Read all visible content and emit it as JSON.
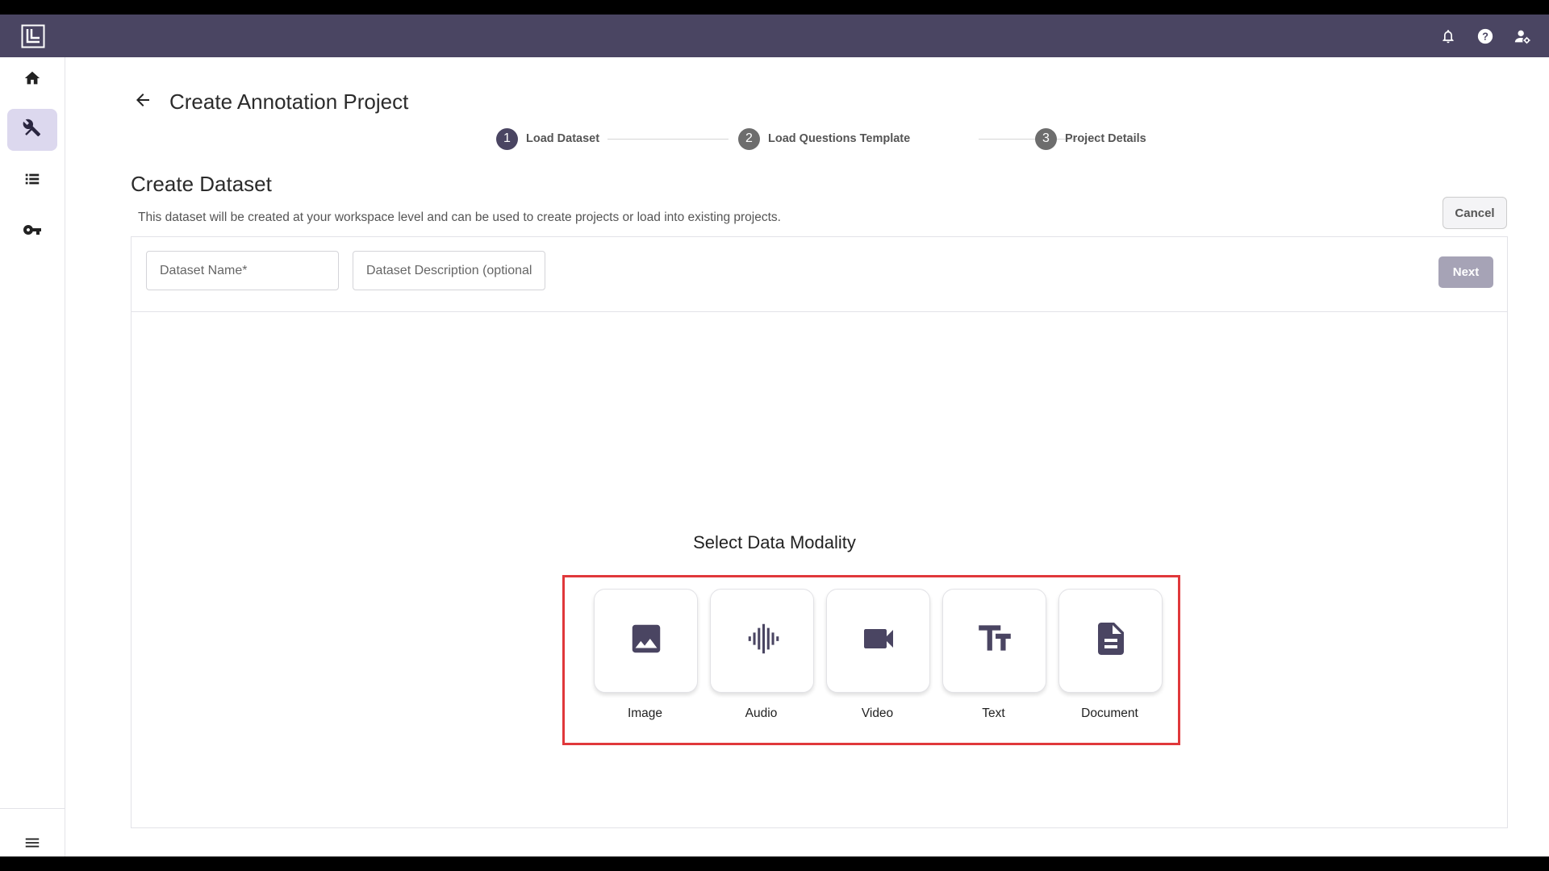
{
  "colors": {
    "topbar": "#4a4562",
    "accent": "#4a4562",
    "step_inactive": "#6d6d6d",
    "highlight": "#e0383b",
    "disabled_button": "#a6a3b6"
  },
  "topbar": {
    "icons": [
      "logo-icon",
      "bell-icon",
      "help-icon",
      "user-settings-icon"
    ]
  },
  "sidebar": {
    "items": [
      "home-icon",
      "tools-icon",
      "list-icon",
      "key-icon"
    ],
    "active": "tools-icon",
    "bottom": "menu-icon"
  },
  "header": {
    "title": "Create Annotation Project"
  },
  "stepper": {
    "steps": [
      {
        "number": "1",
        "label": "Load Dataset",
        "active": true
      },
      {
        "number": "2",
        "label": "Load Questions Template",
        "active": false
      },
      {
        "number": "3",
        "label": "Project Details",
        "active": false
      }
    ]
  },
  "dataset": {
    "title": "Create Dataset",
    "description": "This dataset will be created at your workspace level and can be used to create projects or load into existing projects.",
    "cancel_label": "Cancel",
    "name_placeholder": "Dataset Name*",
    "description_placeholder": "Dataset Description (optional)",
    "next_label": "Next"
  },
  "modality": {
    "title": "Select Data Modality",
    "options": [
      {
        "label": "Image",
        "icon": "image-icon"
      },
      {
        "label": "Audio",
        "icon": "audio-waveform-icon"
      },
      {
        "label": "Video",
        "icon": "videocam-icon"
      },
      {
        "label": "Text",
        "icon": "text-fields-icon"
      },
      {
        "label": "Document",
        "icon": "document-icon"
      }
    ]
  }
}
